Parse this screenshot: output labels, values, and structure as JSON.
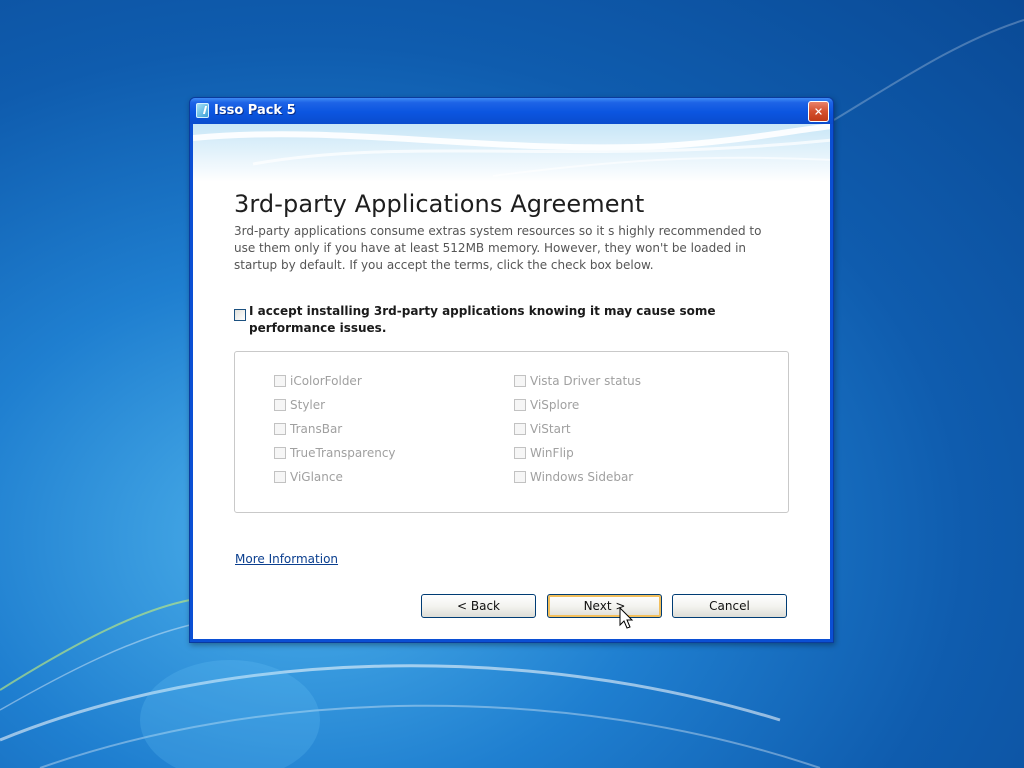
{
  "window": {
    "title": "Isso Pack 5"
  },
  "page": {
    "heading": "3rd-party Applications Agreement",
    "description": "3rd-party applications consume extras system resources so it s highly recommended to use them only if you have at least 512MB memory. However, they won't be loaded in startup by default. If you accept the terms, click the check box below.",
    "accept_label": "I accept installing 3rd-party applications knowing it may cause some performance issues.",
    "accept_checked": false
  },
  "apps": {
    "left": [
      "iColorFolder",
      "Styler",
      "TransBar",
      "TrueTransparency",
      "ViGlance"
    ],
    "right": [
      "Vista Driver status",
      "ViSplore",
      "ViStart",
      "WinFlip",
      "Windows Sidebar"
    ]
  },
  "links": {
    "more_info": "More Information"
  },
  "buttons": {
    "back": "< Back",
    "next": "Next >",
    "cancel": "Cancel"
  },
  "colors": {
    "titlebar": "#0b55e0",
    "close_button": "#d4502e",
    "default_button_highlight": "#f2bf5c",
    "link": "#0b3f8f"
  }
}
